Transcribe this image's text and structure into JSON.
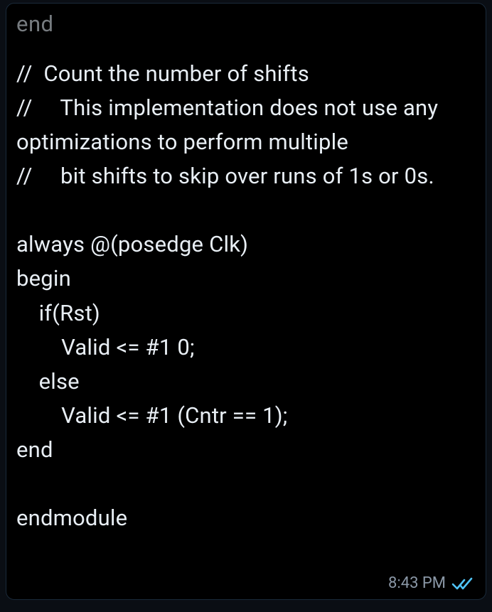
{
  "message": {
    "truncated_top": "end",
    "code": "//  Count the number of shifts\n//     This implementation does not use any optimizations to perform multiple\n//     bit shifts to skip over runs of 1s or 0s.\n\nalways @(posedge Clk)\nbegin\n    if(Rst)\n        Valid <= #1 0;\n    else\n        Valid <= #1 (Cntr == 1);\nend\n\nendmodule",
    "timestamp": "8:43 PM",
    "read_status": "read"
  },
  "colors": {
    "background": "#0a0e14",
    "bubble_bg": "#000000",
    "bubble_border": "#1a2a3a",
    "text": "#e8eef4",
    "timestamp": "#8a97a6",
    "ticks": "#4fc3f7"
  }
}
